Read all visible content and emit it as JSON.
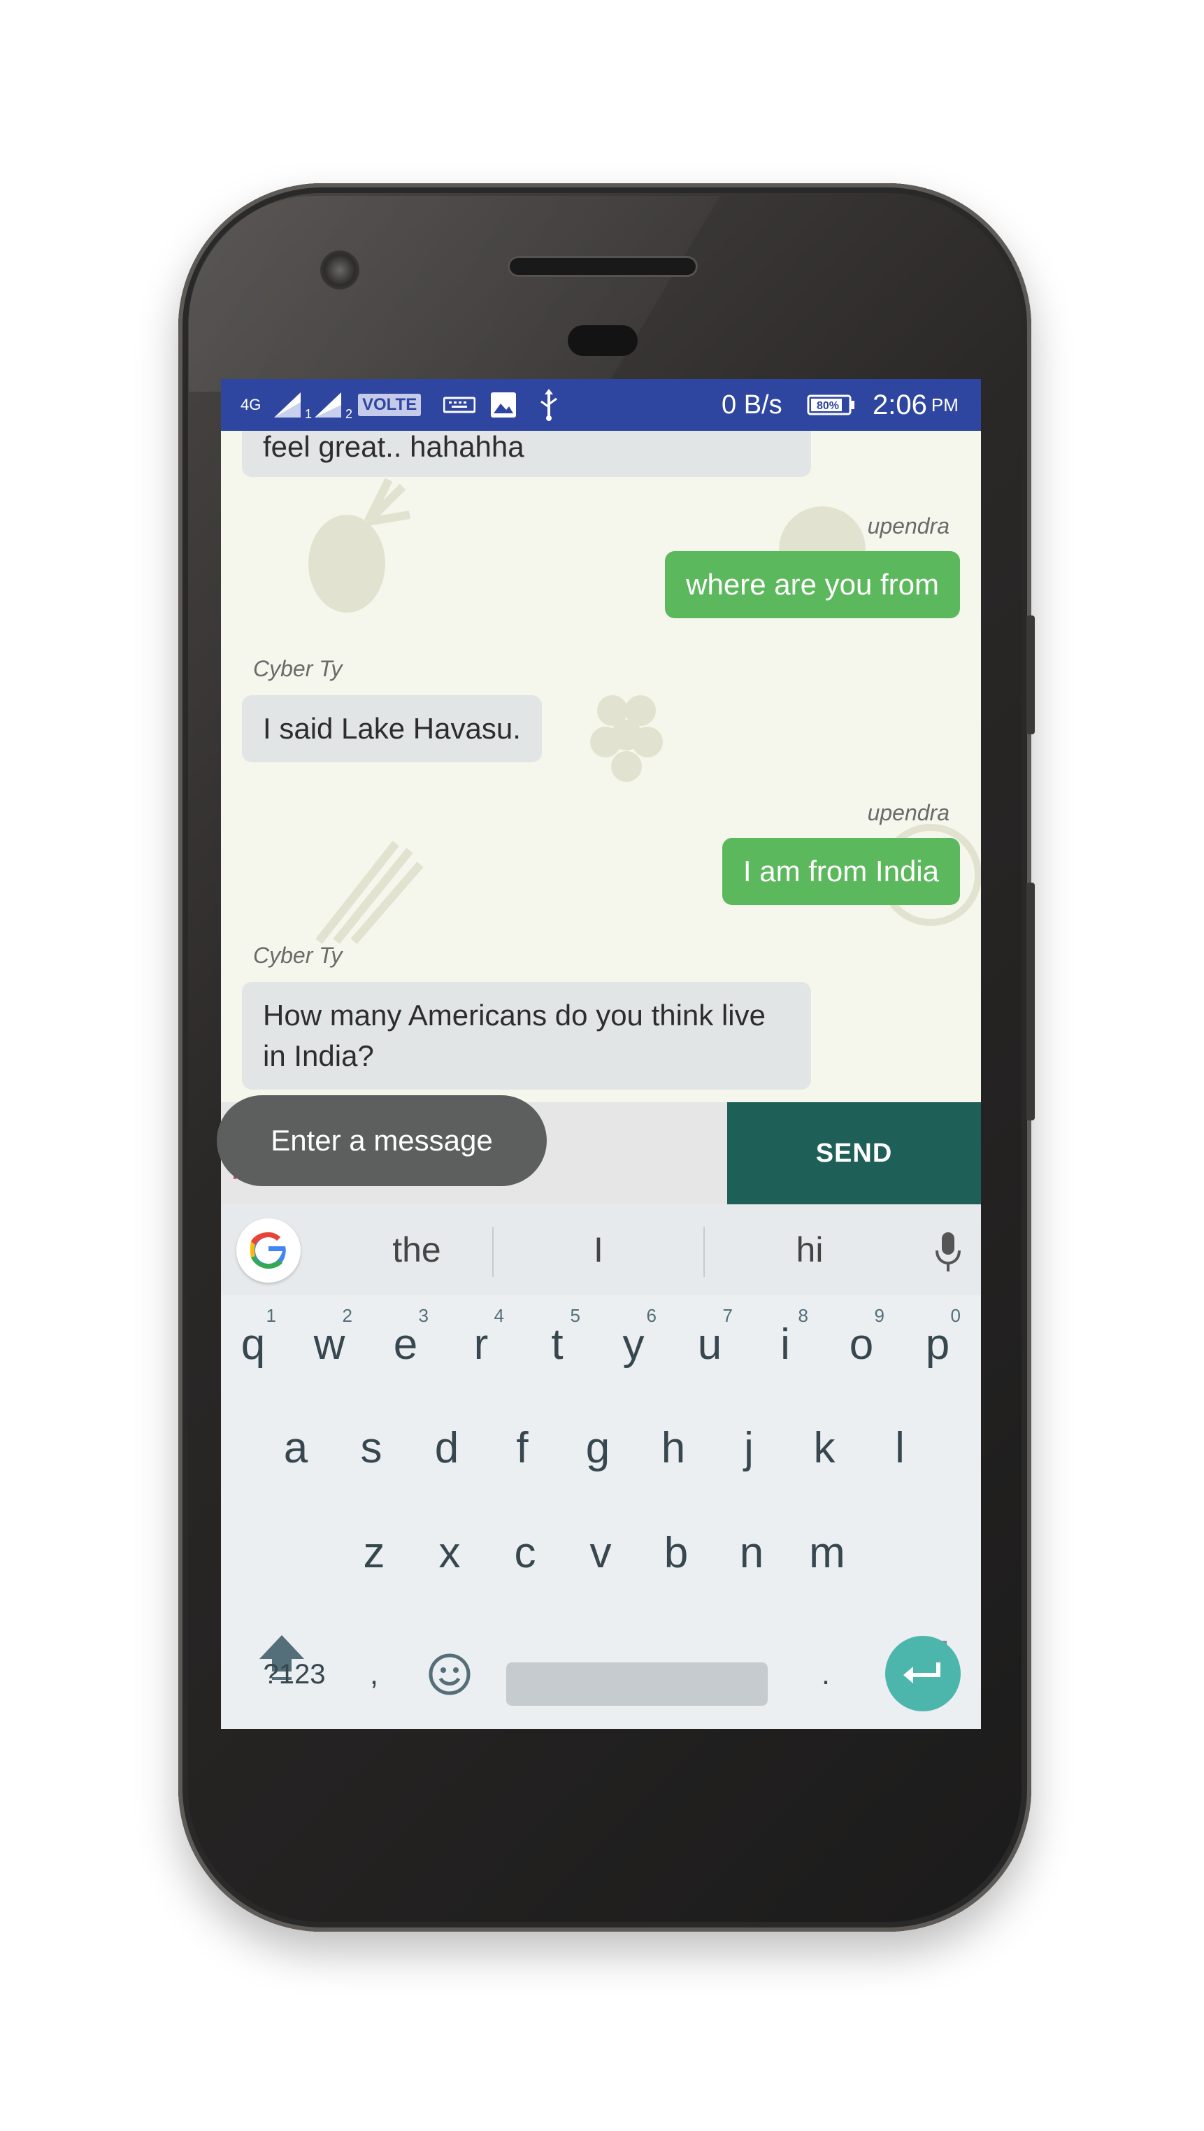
{
  "status_bar": {
    "network": "4G",
    "sim1": "1",
    "sim2": "2",
    "volte": "VOLTE",
    "data_speed": "0 B/s",
    "battery": "80%",
    "time": "2:06",
    "ampm": "PM"
  },
  "chat": {
    "messages": [
      {
        "sender": "",
        "text": "feel great.. hahahha",
        "direction": "incoming"
      },
      {
        "sender": "upendra",
        "text": "where are you from",
        "direction": "outgoing"
      },
      {
        "sender": "Cyber Ty",
        "text": "I said Lake Havasu.",
        "direction": "incoming"
      },
      {
        "sender": "upendra",
        "text": "I am from India",
        "direction": "outgoing"
      },
      {
        "sender": "Cyber Ty",
        "text": "How many Americans do you think live in India?",
        "direction": "incoming"
      }
    ]
  },
  "composer": {
    "input_value": "",
    "send_label": "SEND"
  },
  "keyboard": {
    "suggestions": [
      "the",
      "I",
      "hi"
    ],
    "row1": [
      {
        "key": "q",
        "num": "1"
      },
      {
        "key": "w",
        "num": "2"
      },
      {
        "key": "e",
        "num": "3"
      },
      {
        "key": "r",
        "num": "4"
      },
      {
        "key": "t",
        "num": "5"
      },
      {
        "key": "y",
        "num": "6"
      },
      {
        "key": "u",
        "num": "7"
      },
      {
        "key": "i",
        "num": "8"
      },
      {
        "key": "o",
        "num": "9"
      },
      {
        "key": "p",
        "num": "0"
      }
    ],
    "row2": [
      "a",
      "s",
      "d",
      "f",
      "g",
      "h",
      "j",
      "k",
      "l"
    ],
    "row3": [
      "z",
      "x",
      "c",
      "v",
      "b",
      "n",
      "m"
    ],
    "symbols_label": "?123",
    "comma": ",",
    "period": "."
  },
  "toast": "Enter a message",
  "colors": {
    "status_bar": "#2f46a0",
    "outgoing_bubble": "#5cb85c",
    "incoming_bubble": "#e2e5e6",
    "send_button": "#1e5f57",
    "enter_key": "#4db6ac"
  }
}
